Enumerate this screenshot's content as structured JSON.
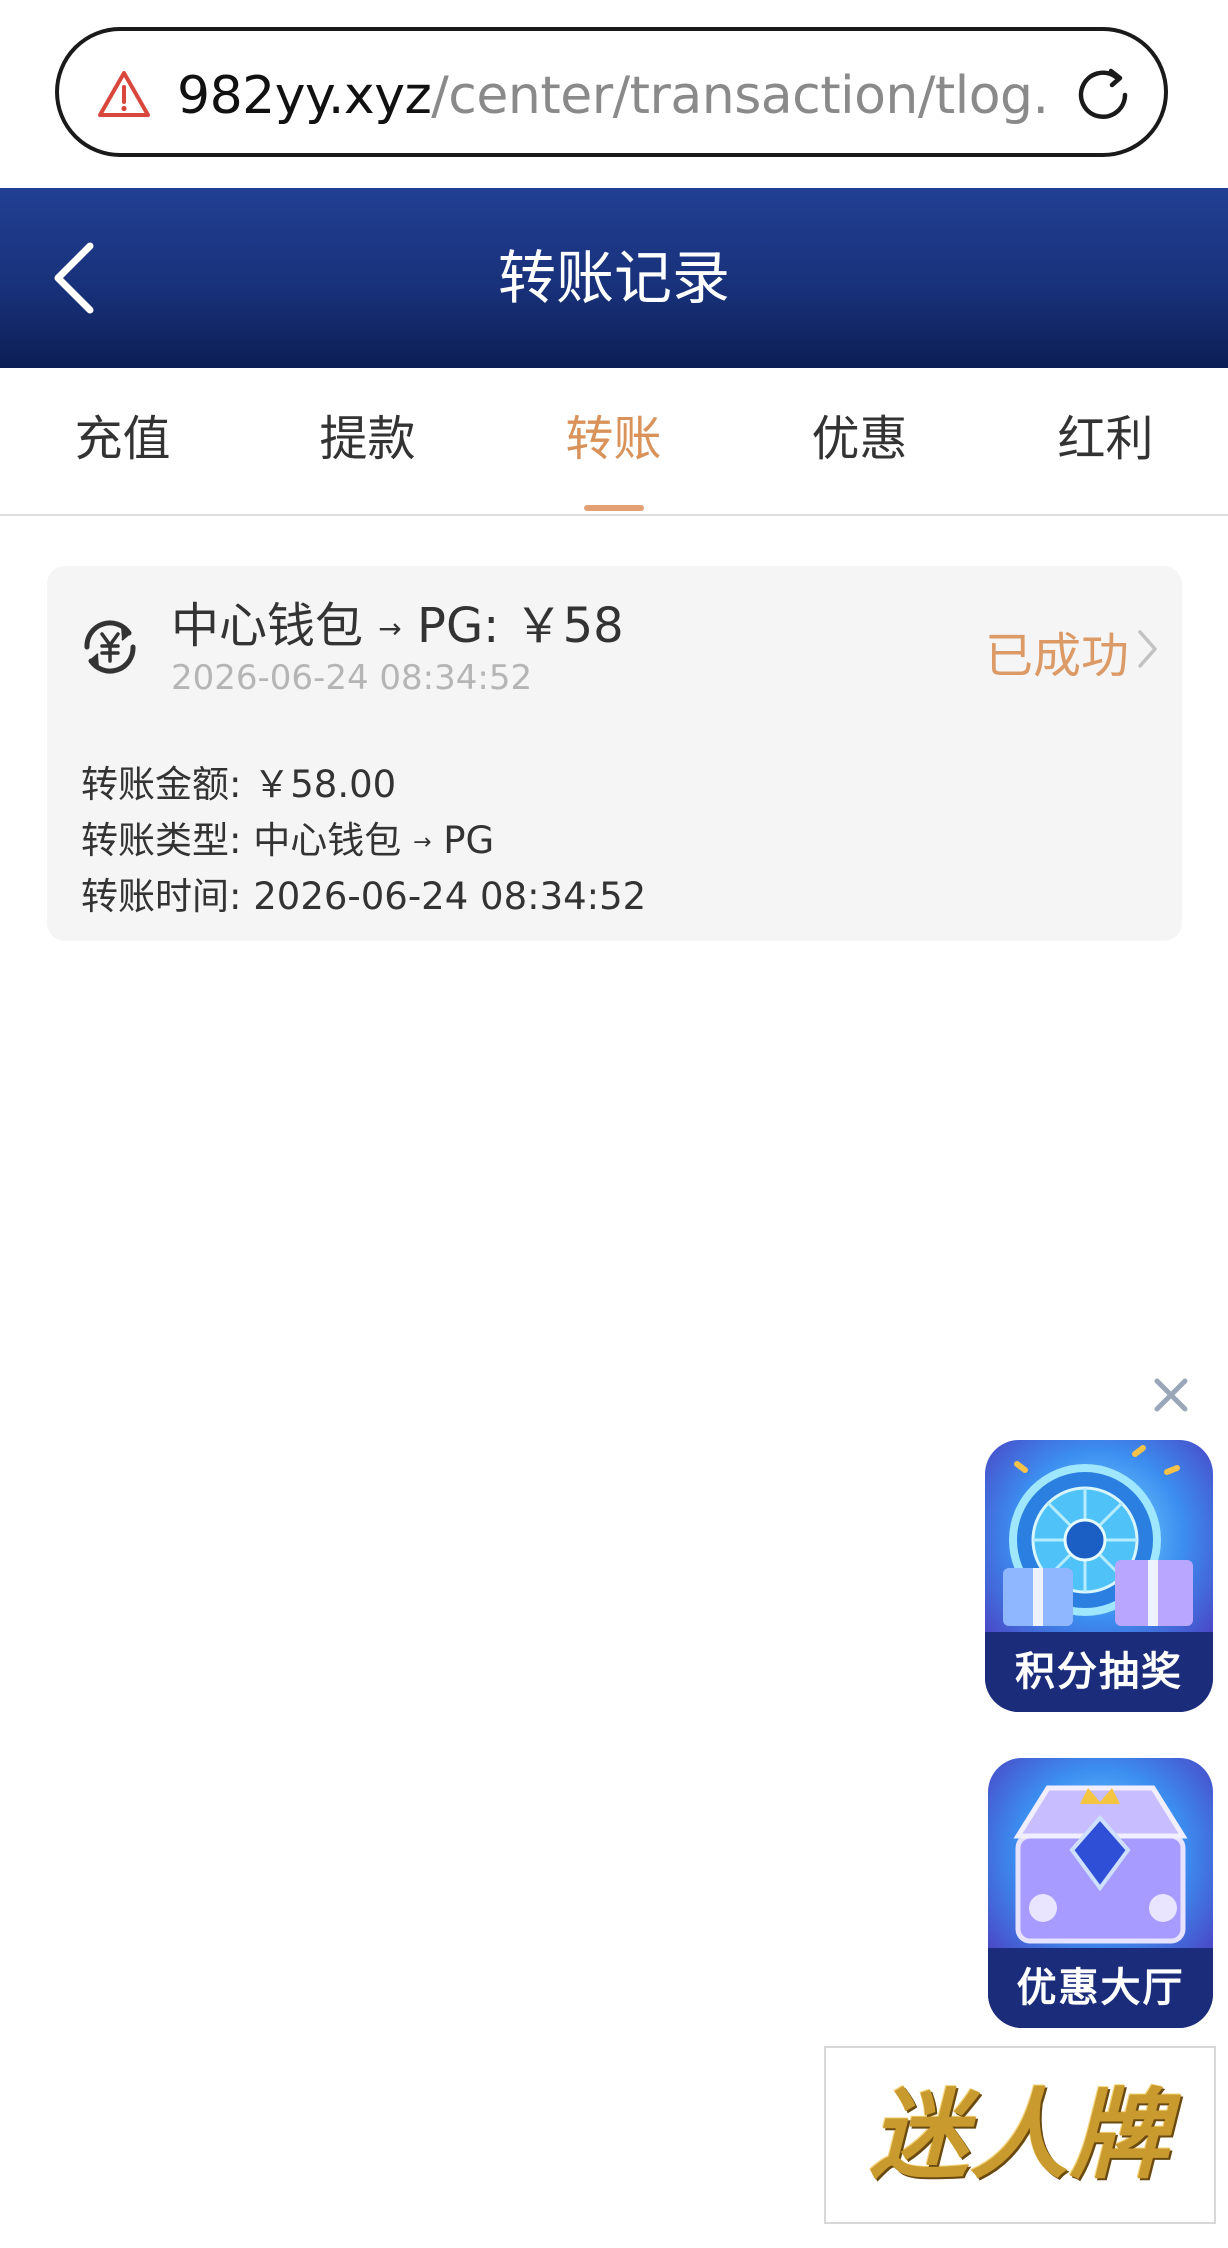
{
  "browser": {
    "url_domain": "982yy.xyz",
    "url_path": "/center/transaction/tlog."
  },
  "header": {
    "title": "转账记录"
  },
  "tabs": [
    {
      "label": "充值",
      "active": false
    },
    {
      "label": "提款",
      "active": false
    },
    {
      "label": "转账",
      "active": true
    },
    {
      "label": "优惠",
      "active": false
    },
    {
      "label": "红利",
      "active": false
    }
  ],
  "record": {
    "from": "中心钱包",
    "arrow": "→",
    "to_amount": "PG:  ￥58",
    "date": "2026-06-24 08:34:52",
    "status": "已成功",
    "details": [
      {
        "label": "转账金额:",
        "value": "￥58.00"
      },
      {
        "label": "转账类型:",
        "value_from": "中心钱包",
        "arrow": "→",
        "value_to": "PG"
      },
      {
        "label": "转账时间:",
        "value": "2026-06-24 08:34:52"
      }
    ]
  },
  "promos": [
    {
      "label": "积分抽奖"
    },
    {
      "label": "优惠大厅"
    }
  ],
  "logo": {
    "text": "迷人牌"
  },
  "colors": {
    "header": "#1a3583",
    "accent": "#dc9a67",
    "card_bg": "#f5f5f5"
  }
}
